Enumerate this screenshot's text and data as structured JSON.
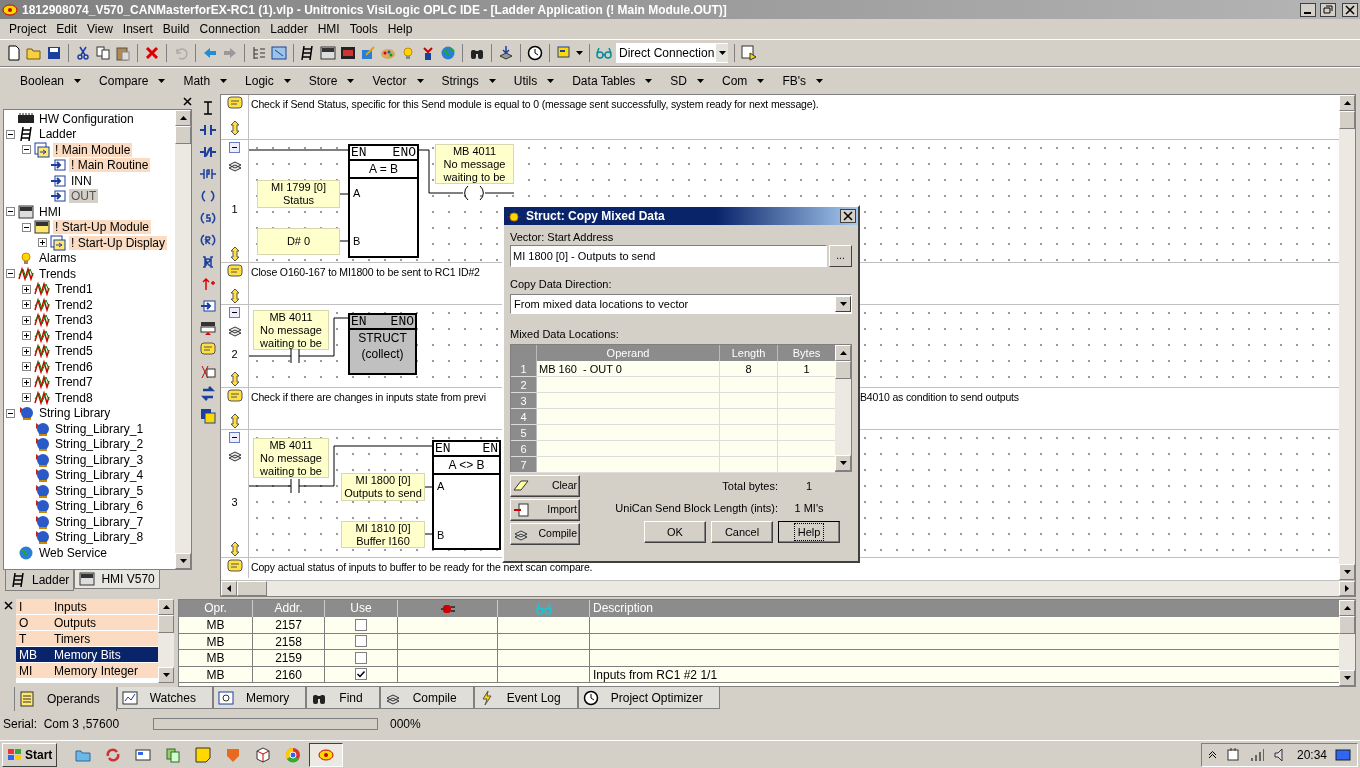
{
  "window": {
    "title": "1812908074_V570_CANMasterforEX-RC1 (1).vlp - Unitronics VisiLogic OPLC IDE - [Ladder Application (! Main Module.OUT)]"
  },
  "menu": [
    "Project",
    "Edit",
    "View",
    "Insert",
    "Build",
    "Connection",
    "Ladder",
    "HMI",
    "Tools",
    "Help"
  ],
  "toolbar": {
    "connection": "Direct Connection"
  },
  "function_menus": [
    "Boolean",
    "Compare",
    "Math",
    "Logic",
    "Store",
    "Vector",
    "Strings",
    "Utils",
    "Data Tables",
    "SD",
    "Com",
    "FB's"
  ],
  "tree": [
    {
      "label": "HW Configuration",
      "kind": "hw",
      "selected": false,
      "marked": false
    },
    {
      "label": "Ladder",
      "kind": "ladder",
      "selected": false,
      "marked": false,
      "expanded": true,
      "children": [
        {
          "label": "! Main Module",
          "kind": "module",
          "selected": false,
          "marked": true,
          "expanded": true,
          "children": [
            {
              "label": "! Main Routine",
              "kind": "routine",
              "selected": false,
              "marked": true
            },
            {
              "label": "INN",
              "kind": "routine",
              "selected": false,
              "marked": false
            },
            {
              "label": "OUT",
              "kind": "routine",
              "selected": true,
              "marked": false
            }
          ]
        }
      ]
    },
    {
      "label": "HMI",
      "kind": "hmi",
      "selected": false,
      "marked": false,
      "expanded": true,
      "children": [
        {
          "label": "! Start-Up Module",
          "kind": "hmimodule",
          "selected": false,
          "marked": true,
          "expanded": true,
          "children": [
            {
              "label": "! Start-Up Display",
              "kind": "module",
              "selected": false,
              "marked": true,
              "expanded": false
            }
          ]
        }
      ]
    },
    {
      "label": "Alarms",
      "kind": "alarm",
      "selected": false,
      "marked": false
    },
    {
      "label": "Trends",
      "kind": "trend",
      "selected": false,
      "marked": false,
      "expanded": true,
      "children": [
        {
          "label": "Trend1",
          "kind": "trend",
          "selected": false,
          "marked": false,
          "expanded": false
        },
        {
          "label": "Trend2",
          "kind": "trend",
          "selected": false,
          "marked": false,
          "expanded": false
        },
        {
          "label": "Trend3",
          "kind": "trend",
          "selected": false,
          "marked": false,
          "expanded": false
        },
        {
          "label": "Trend4",
          "kind": "trend",
          "selected": false,
          "marked": false,
          "expanded": false
        },
        {
          "label": "Trend5",
          "kind": "trend",
          "selected": false,
          "marked": false,
          "expanded": false
        },
        {
          "label": "Trend6",
          "kind": "trend",
          "selected": false,
          "marked": false,
          "expanded": false
        },
        {
          "label": "Trend7",
          "kind": "trend",
          "selected": false,
          "marked": false,
          "expanded": false
        },
        {
          "label": "Trend8",
          "kind": "trend",
          "selected": false,
          "marked": false,
          "expanded": false
        }
      ]
    },
    {
      "label": "String Library",
      "kind": "string",
      "selected": false,
      "marked": false,
      "expanded": true,
      "children": [
        {
          "label": "String_Library_1",
          "kind": "string",
          "selected": false,
          "marked": false
        },
        {
          "label": "String_Library_2",
          "kind": "string",
          "selected": false,
          "marked": false
        },
        {
          "label": "String_Library_3",
          "kind": "string",
          "selected": false,
          "marked": false
        },
        {
          "label": "String_Library_4",
          "kind": "string",
          "selected": false,
          "marked": false
        },
        {
          "label": "String_Library_5",
          "kind": "string",
          "selected": false,
          "marked": false
        },
        {
          "label": "String_Library_6",
          "kind": "string",
          "selected": false,
          "marked": false
        },
        {
          "label": "String_Library_7",
          "kind": "string",
          "selected": false,
          "marked": false
        },
        {
          "label": "String_Library_8",
          "kind": "string",
          "selected": false,
          "marked": false
        }
      ]
    },
    {
      "label": "Web Service",
      "kind": "web",
      "selected": false,
      "marked": false
    }
  ],
  "left_tabs": [
    {
      "label": "Ladder",
      "selected": true
    },
    {
      "label": "HMI V570",
      "selected": false
    }
  ],
  "rungs": [
    {
      "comment": "Check if Send Status, specific for this Send module is equal to 0 (message sent successfully, system ready for next message).",
      "number": "1",
      "contact": false,
      "coil": true,
      "operands": [
        {
          "lines": [
            "MI 1799 [0]",
            "Status"
          ]
        },
        {
          "lines": [
            "D# 0"
          ]
        },
        {
          "lines": [
            "MB 4011",
            "No message",
            "waiting to be"
          ]
        }
      ],
      "block": {
        "en": "EN",
        "eno": "ENO",
        "title": "A = B",
        "inputs": [
          "A",
          "B"
        ],
        "selected": false
      }
    },
    {
      "comment": "Close O160-167 to MI1800 to be sent to RC1 ID#2",
      "number": "2",
      "contact": true,
      "coil": false,
      "operands": [
        {
          "lines": [
            "MB 4011",
            "No message",
            "waiting to be"
          ]
        }
      ],
      "block": {
        "en": "EN",
        "eno": "ENO",
        "title": "STRUCT",
        "subtitle": "(collect)",
        "selected": true
      }
    },
    {
      "comment": "Check if there are changes in inputs state from previ",
      "comment_right": "B4010 as condition to send outputs",
      "number": "3",
      "contact": true,
      "coil": false,
      "operands": [
        {
          "lines": [
            "MB 4011",
            "No message",
            "waiting to be"
          ]
        },
        {
          "lines": [
            "MI 1800 [0]",
            "Outputs to send"
          ]
        },
        {
          "lines": [
            "MI 1810 [0]",
            "Buffer I160"
          ]
        }
      ],
      "block": {
        "en": "EN",
        "eno": "EN",
        "title": "A <> B",
        "inputs": [
          "A",
          "B"
        ],
        "selected": false
      }
    },
    {
      "comment": "Copy actual status of inputs to buffer to be ready for the next scan compare."
    }
  ],
  "dialog": {
    "title": "Struct: Copy Mixed Data",
    "vector_label": "Vector: Start Address",
    "vector_value": "MI 1800 [0] - Outputs to send",
    "browse": "...",
    "direction_label": "Copy Data Direction:",
    "direction_value": "From mixed data locations to vector",
    "locations_label": "Mixed Data Locations:",
    "columns": [
      "Operand",
      "Length",
      "Bytes"
    ],
    "rows": [
      {
        "number": "1",
        "operand": "MB 160  - OUT 0",
        "length": "8",
        "bytes": "1"
      },
      {
        "number": "2"
      },
      {
        "number": "3"
      },
      {
        "number": "4"
      },
      {
        "number": "5"
      },
      {
        "number": "6"
      },
      {
        "number": "7"
      }
    ],
    "side_buttons": [
      "Clear",
      "Import",
      "Compile"
    ],
    "total_label": "Total bytes:",
    "total_value": "1",
    "block_label": "UniCan Send Block Length (ints):",
    "block_value": "1 MI's",
    "buttons": [
      "OK",
      "Cancel",
      "Help"
    ]
  },
  "operand_types": [
    {
      "code": "I",
      "name": "Inputs",
      "selected": false
    },
    {
      "code": "O",
      "name": "Outputs",
      "selected": false
    },
    {
      "code": "T",
      "name": "Timers",
      "selected": false
    },
    {
      "code": "MB",
      "name": "Memory Bits",
      "selected": true
    },
    {
      "code": "MI",
      "name": "Memory Integer",
      "selected": false
    }
  ],
  "operands_table": {
    "columns": [
      "Opr.",
      "Addr.",
      "Use",
      "Description"
    ],
    "rows": [
      {
        "opr": "MB",
        "addr": "2157",
        "use": false
      },
      {
        "opr": "MB",
        "addr": "2158",
        "use": false
      },
      {
        "opr": "MB",
        "addr": "2159",
        "use": false
      },
      {
        "opr": "MB",
        "addr": "2160",
        "use": true,
        "description": "Inputs from RC1 #2 1/1"
      }
    ]
  },
  "bottom_tabs": [
    {
      "label": "Operands",
      "selected": true
    },
    {
      "label": "Watches",
      "selected": false
    },
    {
      "label": "Memory",
      "selected": false
    },
    {
      "label": "Find",
      "selected": false
    },
    {
      "label": "Compile",
      "selected": false
    },
    {
      "label": "Event Log",
      "selected": false
    },
    {
      "label": "Project Optimizer",
      "selected": false
    }
  ],
  "status_bar": {
    "connection": "Serial:  Com 3 ,57600",
    "level": 0,
    "progress": "000%"
  },
  "taskbar": {
    "start": "Start",
    "clock": "20:34"
  }
}
